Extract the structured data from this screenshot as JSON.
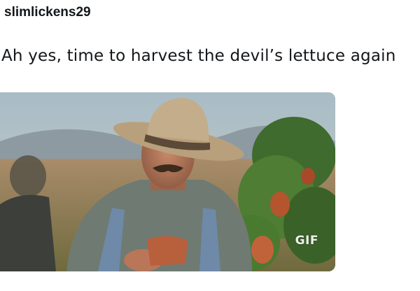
{
  "post": {
    "username": "slimlickens29",
    "text": "Ah yes, time to harvest the devil’s lettuce again",
    "media": {
      "badge": "GIF",
      "subject": "farmer-in-straw-hat-gif"
    }
  },
  "colors": {
    "text": "#14171a",
    "background": "#ffffff",
    "badge": "#ffffff"
  }
}
